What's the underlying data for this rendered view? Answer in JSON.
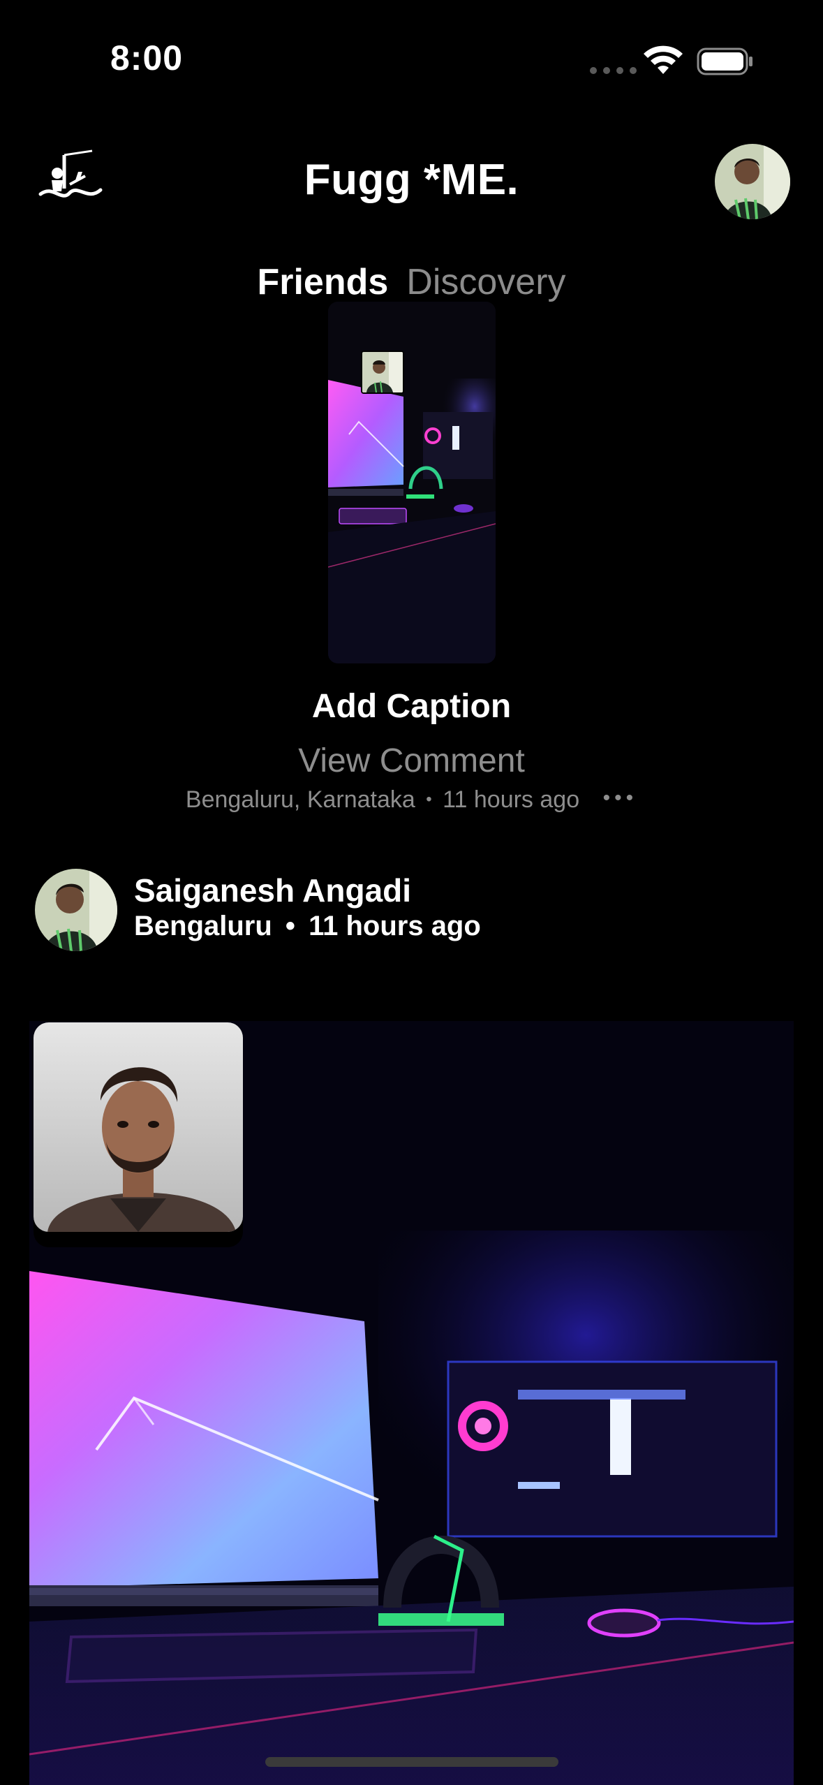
{
  "status_bar": {
    "time": "8:00",
    "icons": [
      "signal-dots-icon",
      "wifi-icon",
      "battery-icon"
    ]
  },
  "header": {
    "logo": "app-logo-icon",
    "title": "Fugg *ME.",
    "avatar": "profile-avatar"
  },
  "tabs": [
    {
      "label": "Friends",
      "active": true
    },
    {
      "label": "Discovery",
      "active": false
    }
  ],
  "my_post": {
    "caption": "Add Caption",
    "view_comment": "View Comment",
    "location": "Bengaluru, Karnataka",
    "time": "11 hours ago",
    "separator": "•",
    "more": "•••"
  },
  "friend_post": {
    "name": "Saiganesh Angadi",
    "location": "Bengaluru",
    "time": "11 hours ago",
    "separator": "•"
  },
  "colors": {
    "background": "#000000",
    "text_primary": "#ffffff",
    "text_secondary": "#8e8e8e",
    "neon_pink": "#e040fb",
    "neon_blue": "#4f6bff"
  }
}
